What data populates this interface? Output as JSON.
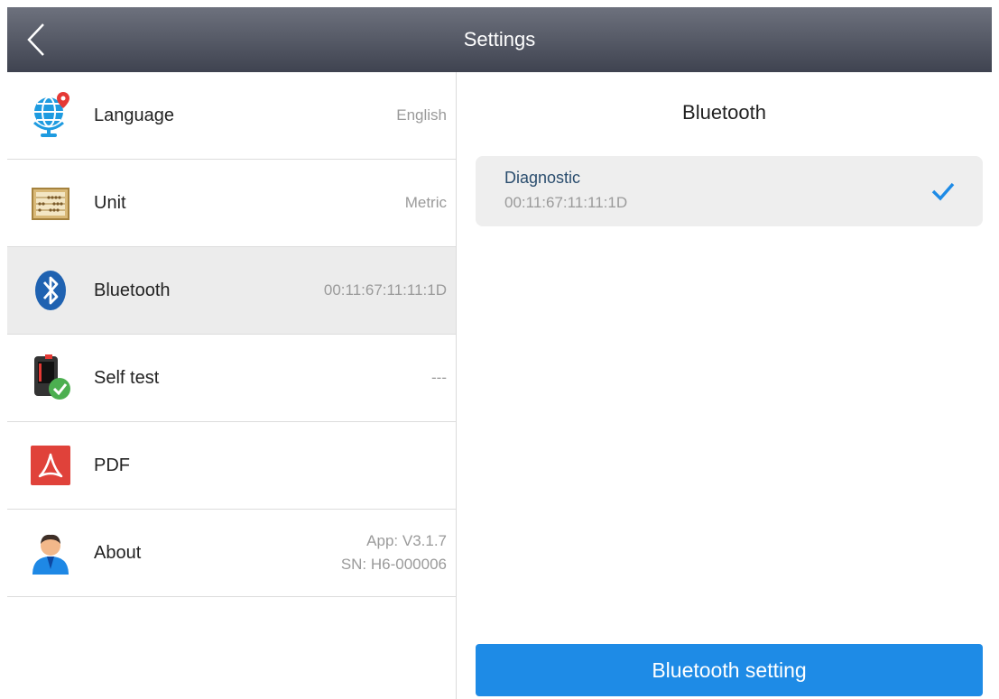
{
  "header": {
    "title": "Settings"
  },
  "settings": [
    {
      "label": "Language",
      "value": "English",
      "icon": "globe-pin-icon"
    },
    {
      "label": "Unit",
      "value": "Metric",
      "icon": "abacus-icon"
    },
    {
      "label": "Bluetooth",
      "value": "00:11:67:11:11:1D",
      "icon": "bluetooth-icon"
    },
    {
      "label": "Self test",
      "value": "---",
      "icon": "device-check-icon"
    },
    {
      "label": "PDF",
      "value": "",
      "icon": "pdf-icon"
    },
    {
      "label": "About",
      "value_line1": "App: V3.1.7",
      "value_line2": "SN: H6-000006",
      "icon": "user-icon"
    }
  ],
  "panel": {
    "title": "Bluetooth",
    "device": {
      "name": "Diagnostic",
      "address": "00:11:67:11:11:1D"
    },
    "button_label": "Bluetooth setting"
  },
  "colors": {
    "accent": "#1e8be6",
    "topbar": "#4b4f5b",
    "selected_row": "#ececec"
  }
}
